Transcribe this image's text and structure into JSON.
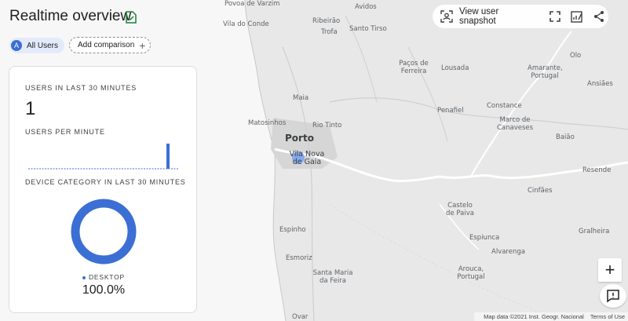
{
  "header": {
    "title": "Realtime overview"
  },
  "chips": {
    "audience": "All Users",
    "audience_initial": "A",
    "add_comparison": "Add comparison"
  },
  "card": {
    "users_label": "USERS IN LAST 30 MINUTES",
    "users_value": "1",
    "per_minute_label": "USERS PER MINUTE",
    "device_label": "DEVICE CATEGORY IN LAST 30 MINUTES",
    "legend_label": "DESKTOP",
    "legend_value": "100.0%",
    "accent": "#3b6fd4"
  },
  "toolbar": {
    "snapshot_label": "View user snapshot"
  },
  "map": {
    "places": [
      "Povoa de Varzim",
      "Avidos",
      "Ribeirão",
      "Santo Tirso",
      "Vila do Conde",
      "Trofa",
      "Paços de Ferreira",
      "Lousada",
      "Olo",
      "Amarante, Portugal",
      "Ansiães",
      "Maia",
      "Penafiel",
      "Constance",
      "Marco de Canaveses",
      "Matosinhos",
      "Rio Tinto",
      "Porto",
      "Vila Nova de Gaia",
      "Baião",
      "Resende",
      "Cinfães",
      "Castelo de Paiva",
      "Espinho",
      "Gralheira",
      "Espiunca",
      "Alvarenga",
      "Esmoriz",
      "Santa Maria da Feira",
      "Arouca, Portugal",
      "Ovar"
    ],
    "attribution": {
      "map_data": "Map data ©2021 Inst. Geogr. Nacional",
      "terms": "Terms of Use"
    }
  }
}
